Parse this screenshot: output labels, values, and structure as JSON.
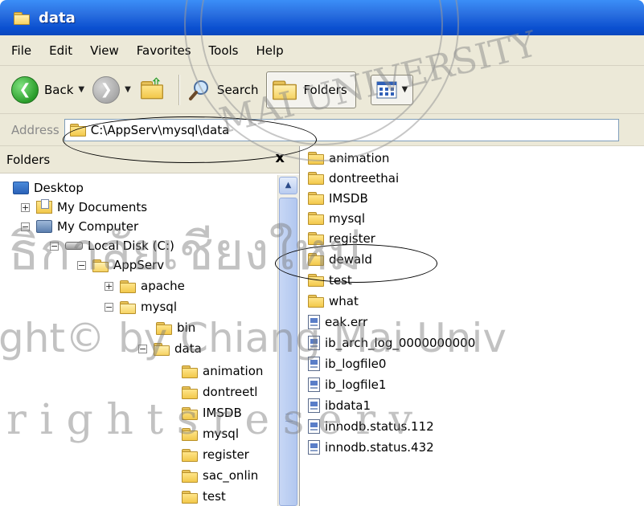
{
  "window": {
    "title": "data"
  },
  "menu": {
    "items": [
      "File",
      "Edit",
      "View",
      "Favorites",
      "Tools",
      "Help"
    ]
  },
  "toolbar": {
    "back_label": "Back",
    "search_label": "Search",
    "folders_label": "Folders"
  },
  "address": {
    "label": "Address",
    "path": "C:\\AppServ\\mysql\\data"
  },
  "folders_pane": {
    "title": "Folders",
    "close": "x",
    "tree": [
      {
        "label": "Desktop"
      },
      {
        "label": "My Documents"
      },
      {
        "label": "My Computer"
      },
      {
        "label": "Local Disk (C:)"
      },
      {
        "label": "AppServ"
      },
      {
        "label": "apache"
      },
      {
        "label": "mysql"
      },
      {
        "label": "bin"
      },
      {
        "label": "data"
      },
      {
        "label": "animation"
      },
      {
        "label": "dontreetl"
      },
      {
        "label": "IMSDB"
      },
      {
        "label": "mysql"
      },
      {
        "label": "register"
      },
      {
        "label": "sac_onlin"
      },
      {
        "label": "test"
      }
    ]
  },
  "files": [
    {
      "name": "animation",
      "type": "folder"
    },
    {
      "name": "dontreethai",
      "type": "folder"
    },
    {
      "name": "IMSDB",
      "type": "folder"
    },
    {
      "name": "mysql",
      "type": "folder"
    },
    {
      "name": "register",
      "type": "folder"
    },
    {
      "name": "dewald",
      "type": "folder"
    },
    {
      "name": "test",
      "type": "folder"
    },
    {
      "name": "what",
      "type": "folder"
    },
    {
      "name": "eak.err",
      "type": "file"
    },
    {
      "name": "ib_arch_log_0000000000",
      "type": "file"
    },
    {
      "name": "ib_logfile0",
      "type": "file"
    },
    {
      "name": "ib_logfile1",
      "type": "file"
    },
    {
      "name": "ibdata1",
      "type": "file"
    },
    {
      "name": "innodb.status.112",
      "type": "file"
    },
    {
      "name": "innodb.status.432",
      "type": "file"
    }
  ],
  "watermark": {
    "line1": "ธิกาลัยเชียงใหม่",
    "line2": "ght© by Chiang Mai Univ",
    "line3": "r i g h t s   r e s e r v",
    "seal": "MAI UNIVERSITY"
  }
}
